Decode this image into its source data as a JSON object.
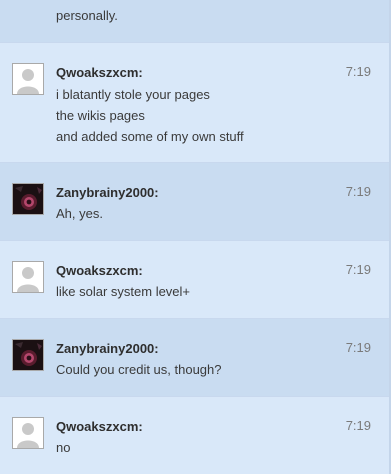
{
  "chat": {
    "top_partial_text": "personally.",
    "messages": [
      {
        "author": "Qwoakszxcm",
        "time": "7:19",
        "avatar": "default-user-icon",
        "lines": [
          "i blatantly stole your pages",
          "the wikis pages",
          "and added some of my own stuff"
        ]
      },
      {
        "author": "Zanybrainy2000",
        "time": "7:19",
        "avatar": "dark-photo-avatar",
        "lines": [
          "Ah, yes."
        ]
      },
      {
        "author": "Qwoakszxcm",
        "time": "7:19",
        "avatar": "default-user-icon",
        "lines": [
          "like solar system level+"
        ]
      },
      {
        "author": "Zanybrainy2000",
        "time": "7:19",
        "avatar": "dark-photo-avatar",
        "lines": [
          "Could you credit us, though?"
        ]
      },
      {
        "author": "Qwoakszxcm",
        "time": "7:19",
        "avatar": "default-user-icon",
        "lines": [
          "no"
        ]
      }
    ]
  }
}
